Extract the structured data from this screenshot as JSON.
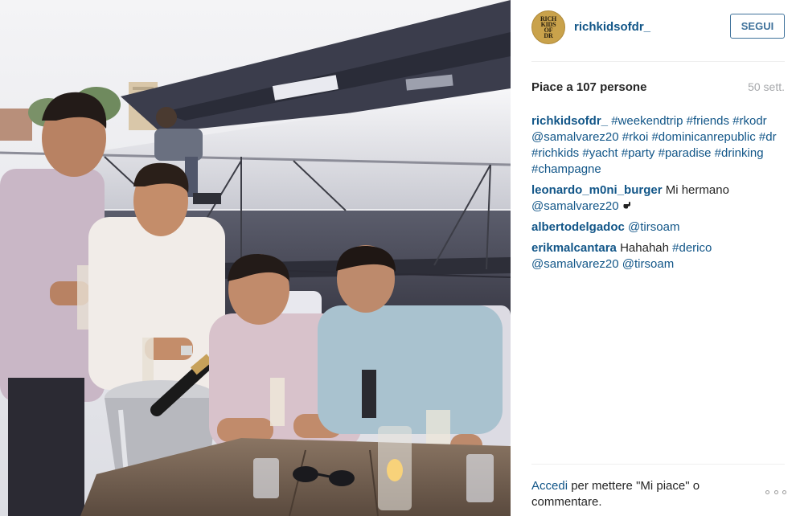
{
  "post": {
    "username": "richkidsofdr_",
    "follow_label": "SEGUI",
    "avatar_logo_text": [
      "RICH",
      "KIDS",
      "OF",
      "DR"
    ],
    "likes_text": "Piace a 107 persone",
    "age_text": "50 sett.",
    "photo_icon": "yacht-party-photo"
  },
  "comments": [
    {
      "user": "richkidsofdr_",
      "parts": [
        {
          "type": "tag",
          "text": "#weekendtrip"
        },
        {
          "type": "tag",
          "text": "#friends"
        },
        {
          "type": "tag",
          "text": "#rkodr"
        },
        {
          "type": "tag",
          "text": "@samalvarez20"
        },
        {
          "type": "tag",
          "text": "#rkoi"
        },
        {
          "type": "tag",
          "text": "#dominicanrepublic"
        },
        {
          "type": "tag",
          "text": "#dr"
        },
        {
          "type": "tag",
          "text": "#richkids"
        },
        {
          "type": "tag",
          "text": "#yacht"
        },
        {
          "type": "tag",
          "text": "#party"
        },
        {
          "type": "tag",
          "text": "#paradise"
        },
        {
          "type": "tag",
          "text": "#drinking"
        },
        {
          "type": "tag",
          "text": "#champagne"
        }
      ]
    },
    {
      "user": "leonardo_m0ni_burger",
      "parts": [
        {
          "type": "text",
          "text": "Mi hermano"
        },
        {
          "type": "tag",
          "text": "@samalvarez20"
        },
        {
          "type": "icon",
          "text": "pointing-hand-icon"
        }
      ]
    },
    {
      "user": "albertodelgadoc",
      "parts": [
        {
          "type": "tag",
          "text": "@tirsoam"
        }
      ]
    },
    {
      "user": "erikmalcantara",
      "parts": [
        {
          "type": "text",
          "text": "Hahahah"
        },
        {
          "type": "tag",
          "text": "#derico"
        },
        {
          "type": "tag",
          "text": "@samalvarez20"
        },
        {
          "type": "tag",
          "text": "@tirsoam"
        }
      ]
    }
  ],
  "footer": {
    "login_link": "Accedi",
    "login_text": " per mettere \"Mi piace\" o commentare.",
    "more_icon": "more-options-icon"
  },
  "colors": {
    "link": "#125688",
    "follow_border": "#3f729b",
    "muted": "#a5a7aa"
  }
}
